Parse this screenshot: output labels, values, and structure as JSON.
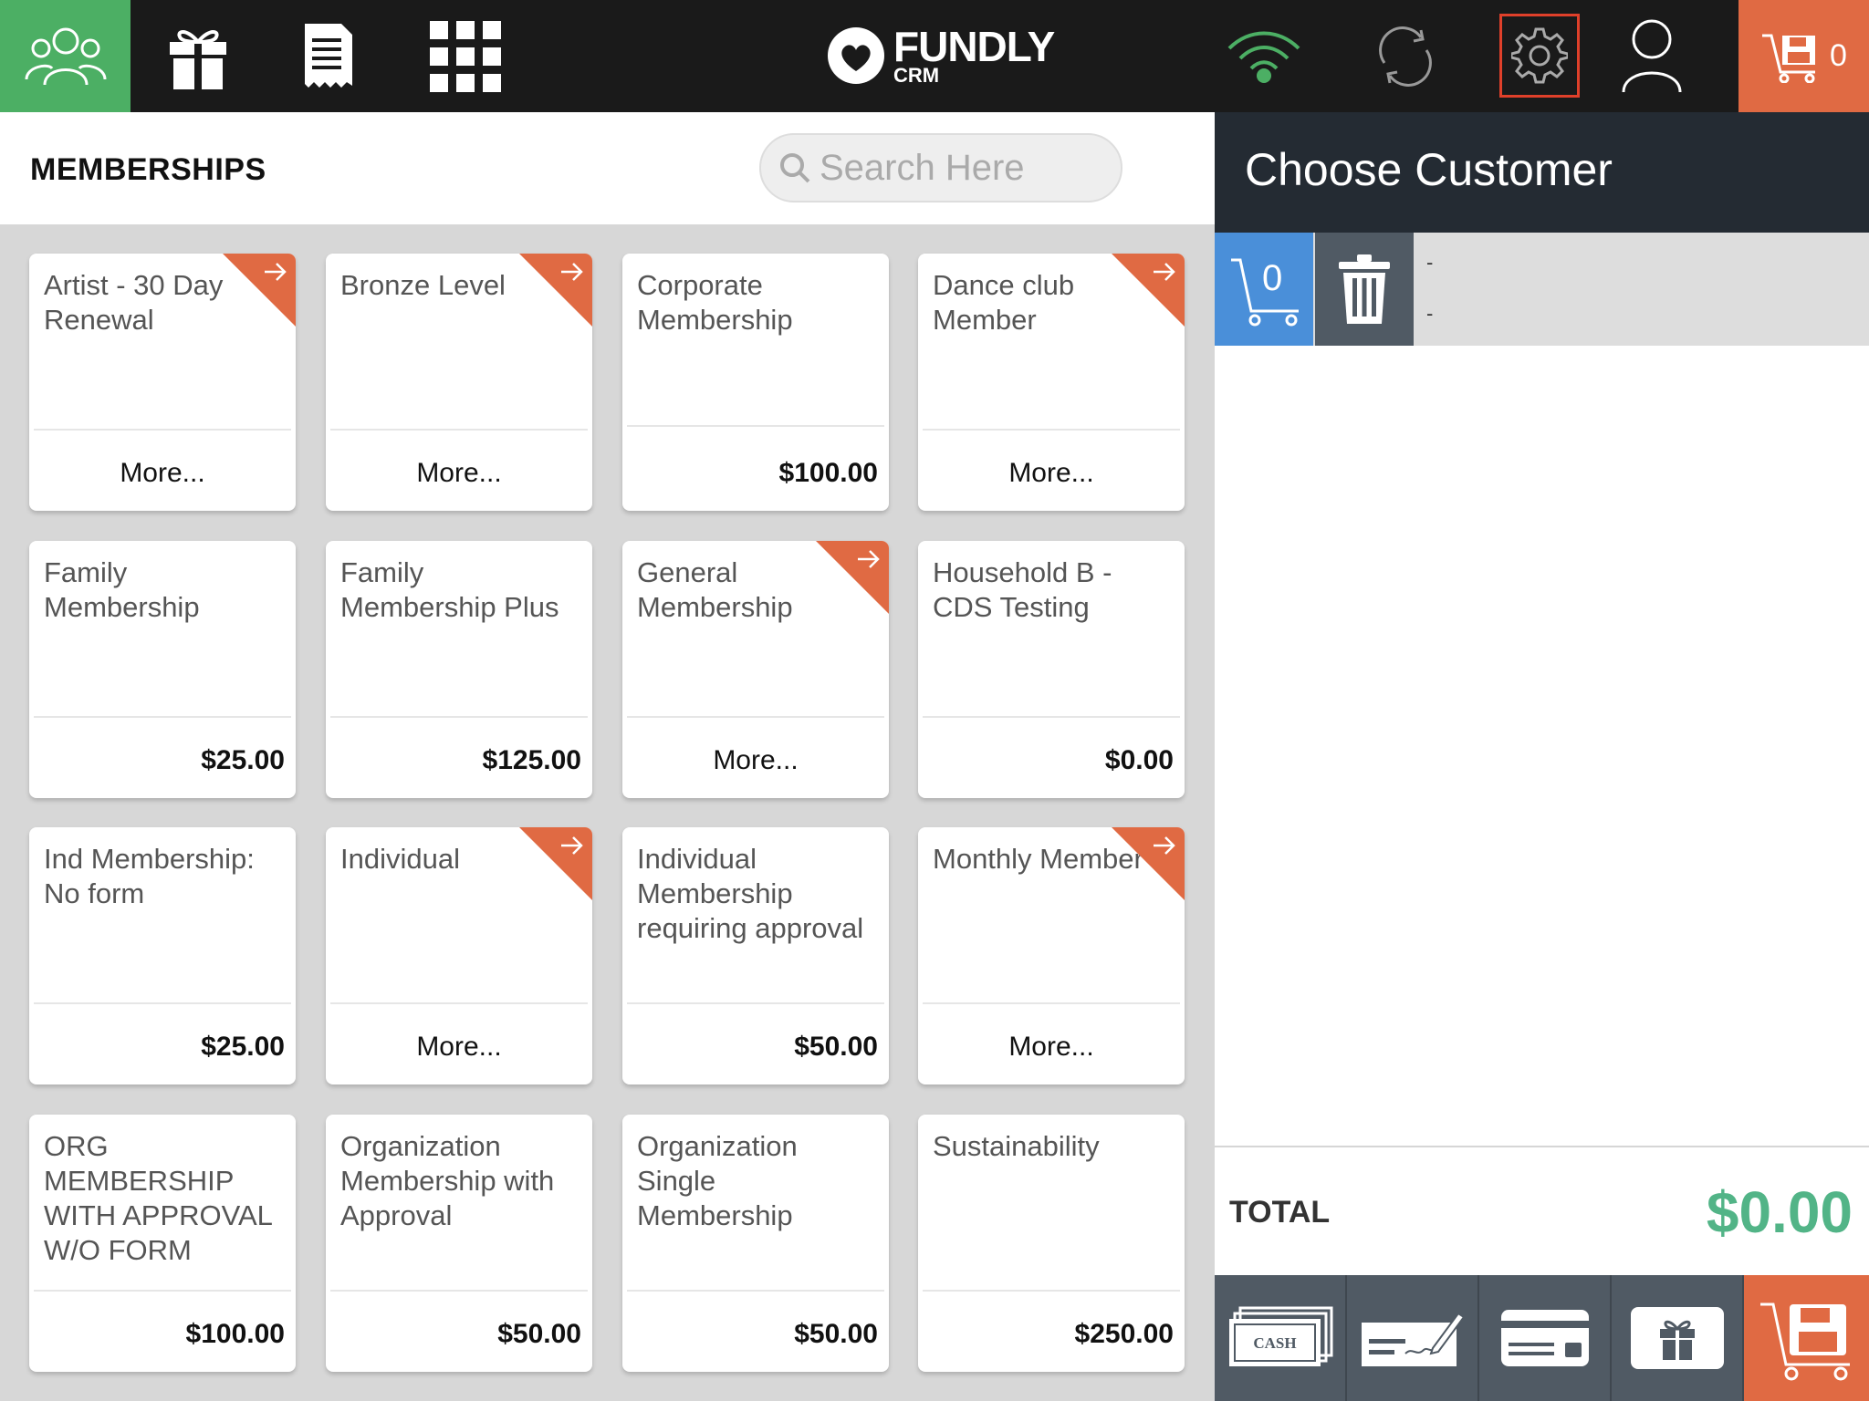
{
  "topbar": {
    "logo_name": "FUNDLY",
    "logo_sub": "CRM",
    "cart_count": "0",
    "icons": [
      "members-icon",
      "gift-icon",
      "receipt-icon",
      "grid-icon",
      "wifi-icon",
      "sync-icon",
      "gear-icon",
      "user-icon",
      "cart-save-icon"
    ]
  },
  "left": {
    "title": "MEMBERSHIPS",
    "search_placeholder": "Search Here"
  },
  "cards": [
    {
      "name": "Artist - 30 Day Renewal",
      "foot": "More...",
      "type": "more",
      "corner": true
    },
    {
      "name": "Bronze Level",
      "foot": "More...",
      "type": "more",
      "corner": true
    },
    {
      "name": "Corporate Membership",
      "foot": "$100.00",
      "type": "price",
      "corner": false
    },
    {
      "name": "Dance club Member",
      "foot": "More...",
      "type": "more",
      "corner": true
    },
    {
      "name": "Family Membership",
      "foot": "$25.00",
      "type": "price",
      "corner": false
    },
    {
      "name": "Family Membership Plus",
      "foot": "$125.00",
      "type": "price",
      "corner": false
    },
    {
      "name": "General Membership",
      "foot": "More...",
      "type": "more",
      "corner": true
    },
    {
      "name": "Household B - CDS Testing",
      "foot": "$0.00",
      "type": "price",
      "corner": false
    },
    {
      "name": "Ind Membership: No form",
      "foot": "$25.00",
      "type": "price",
      "corner": false
    },
    {
      "name": "Individual",
      "foot": "More...",
      "type": "more",
      "corner": true
    },
    {
      "name": "Individual Membership requiring approval",
      "foot": "$50.00",
      "type": "price",
      "corner": false
    },
    {
      "name": "Monthly Member",
      "foot": "More...",
      "type": "more",
      "corner": true
    },
    {
      "name": "ORG MEMBERSHIP WITH APPROVAL W/O FORM",
      "foot": "$100.00",
      "type": "price",
      "corner": false
    },
    {
      "name": "Organization Membership with Approval",
      "foot": "$50.00",
      "type": "price",
      "corner": false
    },
    {
      "name": "Organization Single Membership",
      "foot": "$50.00",
      "type": "price",
      "corner": false
    },
    {
      "name": "Sustainability",
      "foot": "$250.00",
      "type": "price",
      "corner": false
    }
  ],
  "right": {
    "title": "Choose Customer",
    "cart_count": "0",
    "line1": "-",
    "line2": "-",
    "total_label": "TOTAL",
    "total_value": "$0.00",
    "cash_label": "CASH"
  },
  "colors": {
    "accent_green": "#4caf64",
    "accent_orange": "#e06a43",
    "accent_blue": "#4a8fd9",
    "total_green": "#52b487"
  }
}
